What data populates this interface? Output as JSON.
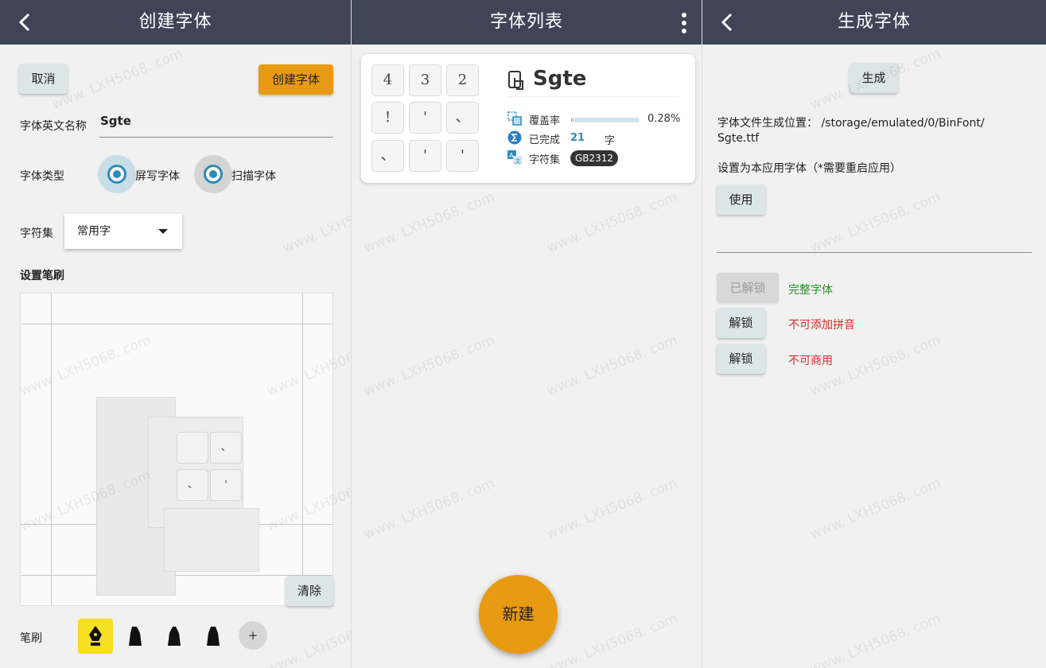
{
  "screen1": {
    "title": "创建字体",
    "cancel_label": "取消",
    "create_label": "创建字体",
    "name_label": "字体英文名称",
    "name_value": "Sgte",
    "type_label": "字体类型",
    "type_options": [
      "屏写字体",
      "扫描字体"
    ],
    "charset_label": "字符集",
    "charset_value": "常用字",
    "brush_settings_label": "设置笔刷",
    "canvas_tiles": [
      "、",
      "、",
      "'"
    ],
    "clear_label": "清除",
    "brush_label": "笔刷",
    "add_brush_label": "+"
  },
  "screen2": {
    "title": "字体列表",
    "card": {
      "glyphs": [
        "4",
        "3",
        "2",
        "!",
        "'",
        "、",
        "、",
        "'",
        "'"
      ],
      "font_name": "Sgte",
      "coverage_label": "覆盖率",
      "coverage_value": "0.28%",
      "coverage_fraction": 0.0028,
      "done_label": "已完成",
      "done_count": "21",
      "done_unit": "字",
      "charset_label": "字符集",
      "charset_value": "GB2312"
    },
    "fab_label": "新建"
  },
  "screen3": {
    "title": "生成字体",
    "generate_label": "生成",
    "path_text_1": "字体文件生成位置： /storage/emulated/0/BinFont/",
    "path_text_2": "Sgte.ttf",
    "set_app_font_text": "设置为本应用字体（*需要重启应用）",
    "use_label": "使用",
    "unlock_rows": [
      {
        "button": "已解锁",
        "desc": "完整字体",
        "state": "unlocked"
      },
      {
        "button": "解锁",
        "desc": "不可添加拼音",
        "state": "locked"
      },
      {
        "button": "解锁",
        "desc": "不可商用",
        "state": "locked"
      }
    ]
  },
  "watermark": "www. LXH5068. com",
  "colors": {
    "appbar": "#3f4557",
    "accent_orange": "#e79a12",
    "accent_blue": "#2d8bbd",
    "green_text": "#2a8c2a",
    "red_text": "#d62b2b"
  }
}
